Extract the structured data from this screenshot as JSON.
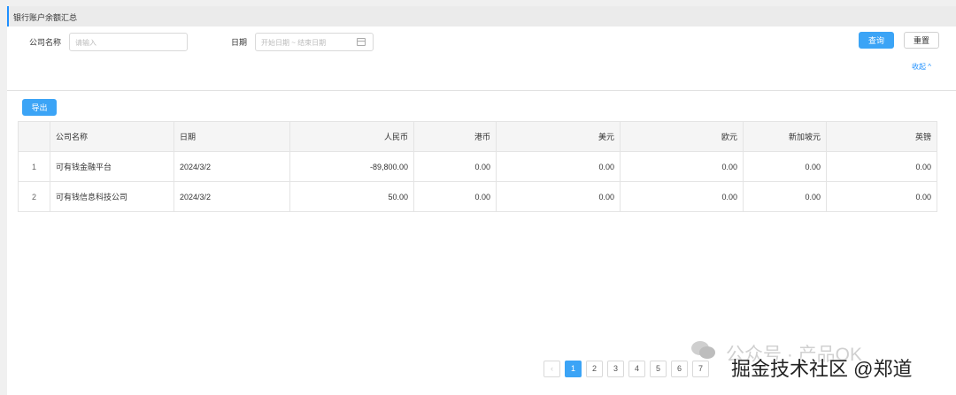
{
  "page": {
    "title": "银行账户余额汇总"
  },
  "filters": {
    "company_label": "公司名称",
    "company_placeholder": "请输入",
    "date_label": "日期",
    "date_placeholder": "开始日期 ~ 结束日期"
  },
  "actions": {
    "query": "查询",
    "reset": "重置",
    "collapse": "收起 ^",
    "export": "导出"
  },
  "table": {
    "headers": [
      "",
      "公司名称",
      "日期",
      "人民币",
      "港币",
      "美元",
      "欧元",
      "新加坡元",
      "英镑"
    ],
    "rows": [
      [
        "1",
        "可有钱金融平台",
        "2024/3/2",
        "-89,800.00",
        "0.00",
        "0.00",
        "0.00",
        "0.00",
        "0.00"
      ],
      [
        "2",
        "可有钱信息科技公司",
        "2024/3/2",
        "50.00",
        "0.00",
        "0.00",
        "0.00",
        "0.00",
        "0.00"
      ]
    ]
  },
  "pagination": {
    "prev": "‹",
    "pages": [
      "1",
      "2",
      "3",
      "4",
      "5",
      "6",
      "7"
    ],
    "current": "1"
  },
  "watermark": {
    "line1": "公众号 · 产品OK",
    "line2": "掘金技术社区 @郑道"
  },
  "colors": {
    "primary": "#3ba4f6",
    "accent": "#1e90ff"
  }
}
